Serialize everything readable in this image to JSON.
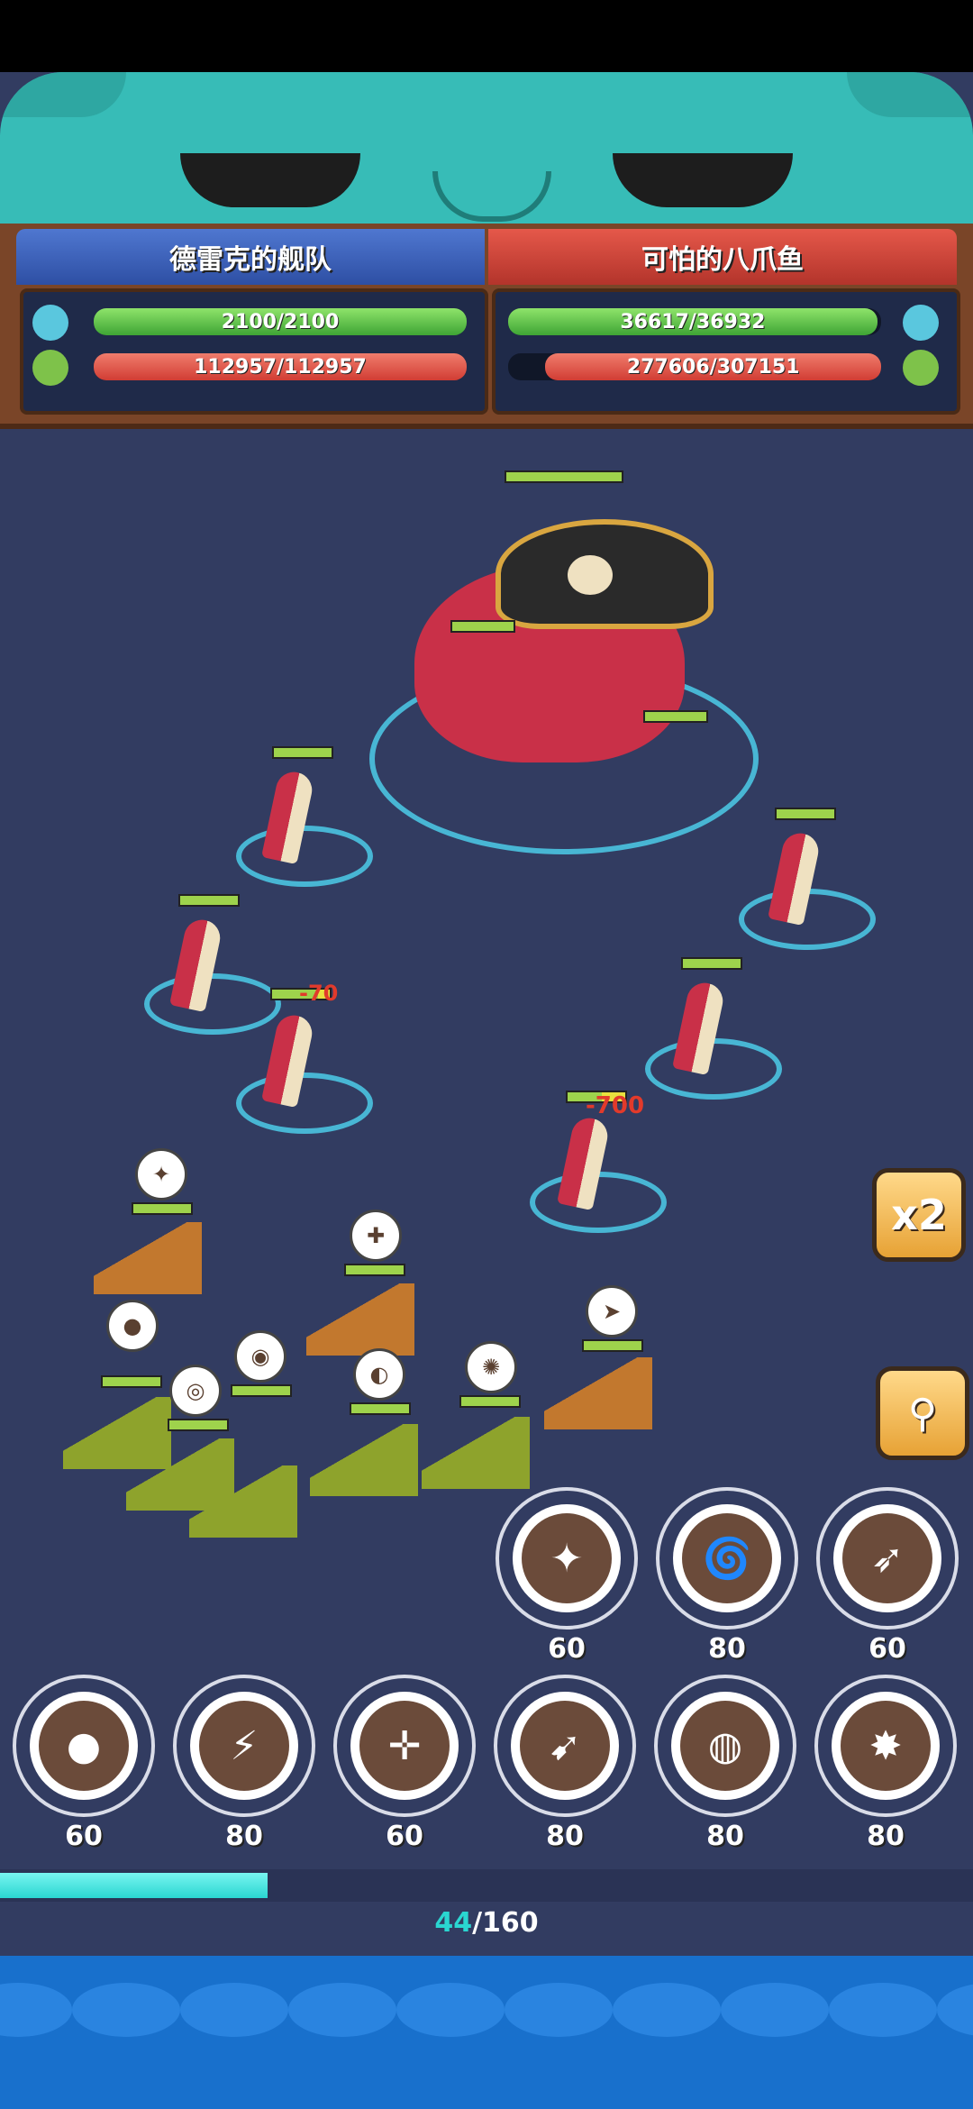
{
  "header": {
    "left_team_name": "德雷克的舰队",
    "right_team_name": "可怕的八爪鱼",
    "left_crew_hp": "2100/2100",
    "left_fleet_hp": "112957/112957",
    "right_crew_hp": "36617/36932",
    "right_fleet_hp": "277606/307151",
    "left_crew_fraction": 1.0,
    "left_fleet_fraction": 1.0,
    "right_crew_fraction": 0.99,
    "right_fleet_fraction": 0.9
  },
  "battle": {
    "damage_popup_1": "-700",
    "damage_popup_2": "-70"
  },
  "controls": {
    "speed_label": "x2",
    "zoom_icon": "magnifier-icon"
  },
  "skills_top": [
    {
      "icon": "burst-icon",
      "cost": "60"
    },
    {
      "icon": "tornado-icon",
      "cost": "80"
    },
    {
      "icon": "shark-icon",
      "cost": "60"
    }
  ],
  "skills_bottom": [
    {
      "icon": "cannonball-icon",
      "cost": "60"
    },
    {
      "icon": "lightning-orb-icon",
      "cost": "80"
    },
    {
      "icon": "compass-icon",
      "cost": "60"
    },
    {
      "icon": "rocket-icon",
      "cost": "80"
    },
    {
      "icon": "bomb-icon",
      "cost": "80"
    },
    {
      "icon": "explosion-icon",
      "cost": "80"
    }
  ],
  "energy": {
    "current": "44",
    "max": "/160",
    "fraction": 0.275
  },
  "colors": {
    "sea": "#323c61",
    "accent": "#2ad6d1",
    "left_team": "#2e4fa4",
    "right_team": "#b3342b"
  }
}
